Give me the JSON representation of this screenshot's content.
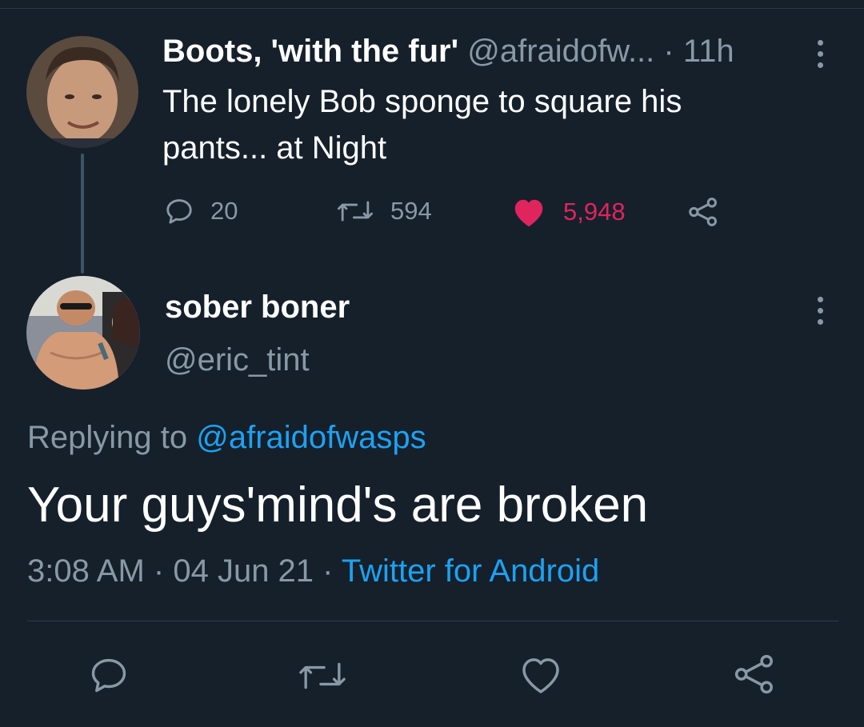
{
  "parent_tweet": {
    "display_name": "Boots, 'with the fur'",
    "handle": "@afraidofw...",
    "separator": "·",
    "time_ago": "11h",
    "text_line1": "The lonely Bob sponge to square his",
    "text_line2": "pants... at Night",
    "reply_count": "20",
    "retweet_count": "594",
    "like_count": "5,948",
    "liked": true
  },
  "reply_tweet": {
    "display_name": "sober boner",
    "handle": "@eric_tint",
    "replying_prefix": "Replying to",
    "replying_handle": "@afraidofwasps",
    "text": "Your guys'mind's are broken",
    "time": "3:08 AM",
    "separator": "·",
    "date": "04 Jun 21",
    "source": "Twitter for Android"
  },
  "icons": {
    "reply": "reply-icon",
    "retweet": "retweet-icon",
    "like": "heart-icon",
    "share": "share-icon",
    "more": "more-options-icon"
  },
  "colors": {
    "background": "#15202b",
    "muted": "#8899a6",
    "link": "#1da1f2",
    "like": "#e0245e"
  }
}
